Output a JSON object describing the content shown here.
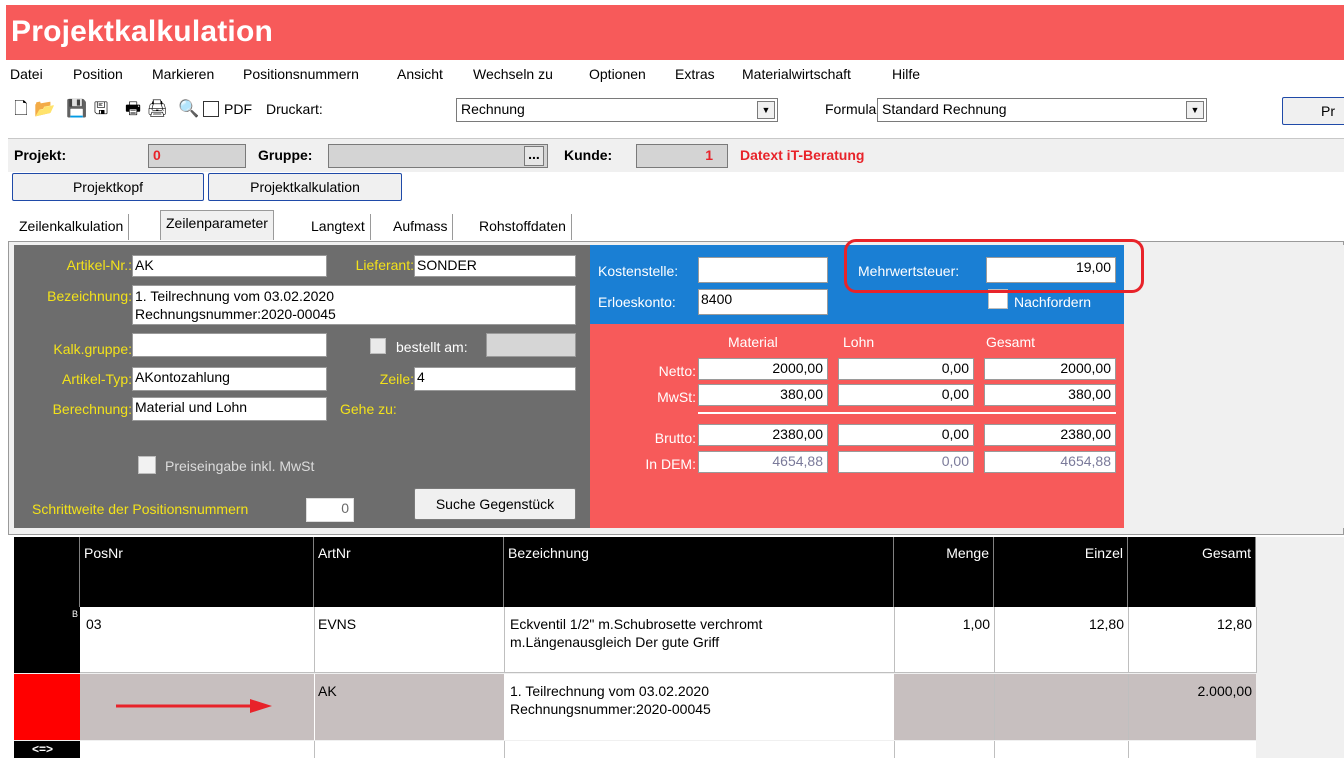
{
  "window": {
    "title": "Projektkalkulation"
  },
  "menu": [
    "Datei",
    "Position",
    "Markieren",
    "Positionsnummern",
    "Ansicht",
    "Wechseln zu",
    "Optionen",
    "Extras",
    "Materialwirtschaft",
    "Hilfe"
  ],
  "toolbar": {
    "pdf_label": "PDF",
    "druckart_label": "Druckart:",
    "druckart_value": "Rechnung",
    "formular_label": "Formular:",
    "formular_value": "Standard Rechnung",
    "right_button": "Pr"
  },
  "project": {
    "projekt_label": "Projekt:",
    "projekt_value": "0",
    "gruppe_label": "Gruppe:",
    "gruppe_value": "",
    "gruppe_button": "...",
    "kunde_label": "Kunde:",
    "kunde_value": "1",
    "kunde_name": "Datext iT-Beratung"
  },
  "nav_buttons": [
    "Projektkopf",
    "Projektkalkulation"
  ],
  "tabs": [
    "Zeilenkalkulation",
    "Zeilenparameter",
    "Langtext",
    "Aufmass",
    "Rohstoffdaten"
  ],
  "params": {
    "artikel_nr_label": "Artikel-Nr.:",
    "artikel_nr": "AK",
    "lieferant_label": "Lieferant:",
    "lieferant": "SONDER",
    "bezeichnung_label": "Bezeichnung:",
    "bezeichnung_line1": "1. Teilrechnung vom 03.02.2020",
    "bezeichnung_line2": "Rechnungsnummer:2020-00045",
    "kalk_gruppe_label": "Kalk.gruppe:",
    "kalk_gruppe": "",
    "bestellt_label": "bestellt am:",
    "bestellt": "",
    "artikel_typ_label": "Artikel-Typ:",
    "artikel_typ": "AKontozahlung",
    "zeile_label": "Zeile:",
    "zeile": "4",
    "berechnung_label": "Berechnung:",
    "berechnung": "Material und Lohn",
    "gehe_zu_label": "Gehe zu:",
    "preiseingabe_label": "Preiseingabe inkl. MwSt",
    "schrittweite_label": "Schrittweite der Positionsnummern",
    "schrittweite": "0",
    "suche_button": "Suche Gegenstück"
  },
  "costs": {
    "kostenstelle_label": "Kostenstelle:",
    "kostenstelle": "",
    "erloeskonto_label": "Erloeskonto:",
    "erloeskonto": "8400",
    "mwst_label": "Mehrwertsteuer:",
    "mwst": "19,00",
    "nachfordern_label": "Nachfordern",
    "col_material": "Material",
    "col_lohn": "Lohn",
    "col_gesamt": "Gesamt",
    "rows": [
      {
        "label": "Netto:",
        "material": "2000,00",
        "lohn": "0,00",
        "gesamt": "2000,00"
      },
      {
        "label": "MwSt:",
        "material": "380,00",
        "lohn": "0,00",
        "gesamt": "380,00"
      },
      {
        "label": "Brutto:",
        "material": "2380,00",
        "lohn": "0,00",
        "gesamt": "2380,00"
      },
      {
        "label": "In DEM:",
        "material": "4654,88",
        "lohn": "0,00",
        "gesamt": "4654,88"
      }
    ]
  },
  "grid": {
    "headers": [
      "PosNr",
      "ArtNr",
      "Bezeichnung",
      "Menge",
      "Einzel",
      "Gesamt"
    ],
    "rows": [
      {
        "marker": "B",
        "posnr": "03",
        "artnr": "EVNS",
        "bez1": "Eckventil 1/2\" m.Schubrosette verchromt",
        "bez2": "m.Längenausgleich Der gute Griff",
        "menge": "1,00",
        "einzel": "12,80",
        "gesamt": "12,80"
      },
      {
        "marker": "",
        "posnr": "",
        "artnr": "AK",
        "bez1": "1. Teilrechnung vom 03.02.2020",
        "bez2": "Rechnungsnummer:2020-00045",
        "menge": "",
        "einzel": "",
        "gesamt": "2.000,00"
      },
      {
        "marker": "<=>",
        "posnr": "",
        "artnr": "",
        "bez1": "",
        "bez2": "",
        "menge": "",
        "einzel": "",
        "gesamt": ""
      }
    ]
  },
  "colors": {
    "title_red": "#f75a5a",
    "panel_gray": "#6d6d6d",
    "panel_blue": "#1a7fd4",
    "label_yellow": "#f3e21a",
    "highlight_red": "#e8232a"
  }
}
